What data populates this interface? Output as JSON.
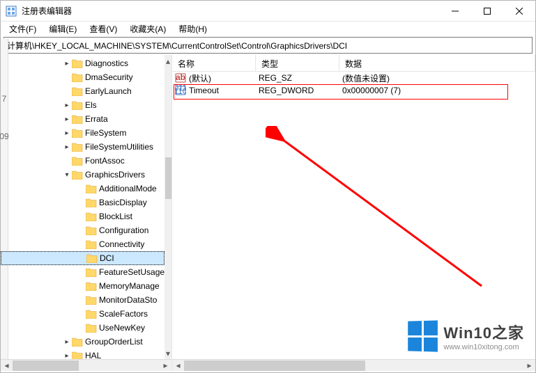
{
  "window": {
    "title": "注册表编辑器"
  },
  "menu": {
    "file": "文件(F)",
    "edit": "编辑(E)",
    "view": "查看(V)",
    "favorites": "收藏夹(A)",
    "help": "帮助(H)"
  },
  "path": "计算机\\HKEY_LOCAL_MACHINE\\SYSTEM\\CurrentControlSet\\Control\\GraphicsDrivers\\DCI",
  "tree": [
    {
      "indent": 88,
      "chev": ">",
      "label": "Diagnostics"
    },
    {
      "indent": 88,
      "chev": "",
      "label": "DmaSecurity"
    },
    {
      "indent": 88,
      "chev": "",
      "label": "EarlyLaunch"
    },
    {
      "indent": 88,
      "chev": ">",
      "label": "Els"
    },
    {
      "indent": 88,
      "chev": ">",
      "label": "Errata"
    },
    {
      "indent": 88,
      "chev": ">",
      "label": "FileSystem"
    },
    {
      "indent": 88,
      "chev": ">",
      "label": "FileSystemUtilities"
    },
    {
      "indent": 88,
      "chev": "",
      "label": "FontAssoc"
    },
    {
      "indent": 88,
      "chev": "v",
      "label": "GraphicsDrivers"
    },
    {
      "indent": 108,
      "chev": "",
      "label": "AdditionalMode"
    },
    {
      "indent": 108,
      "chev": "",
      "label": "BasicDisplay"
    },
    {
      "indent": 108,
      "chev": "",
      "label": "BlockList"
    },
    {
      "indent": 108,
      "chev": "",
      "label": "Configuration"
    },
    {
      "indent": 108,
      "chev": "",
      "label": "Connectivity"
    },
    {
      "indent": 108,
      "chev": "",
      "label": "DCI",
      "selected": true
    },
    {
      "indent": 108,
      "chev": "",
      "label": "FeatureSetUsage"
    },
    {
      "indent": 108,
      "chev": "",
      "label": "MemoryManage"
    },
    {
      "indent": 108,
      "chev": "",
      "label": "MonitorDataSto"
    },
    {
      "indent": 108,
      "chev": "",
      "label": "ScaleFactors"
    },
    {
      "indent": 108,
      "chev": "",
      "label": "UseNewKey"
    },
    {
      "indent": 88,
      "chev": ">",
      "label": "GroupOrderList"
    },
    {
      "indent": 88,
      "chev": ">",
      "label": "HAL"
    }
  ],
  "columns": {
    "name": "名称",
    "type": "类型",
    "data": "数据"
  },
  "values": [
    {
      "icon": "str",
      "name": "(默认)",
      "type": "REG_SZ",
      "data": "(数值未设置)"
    },
    {
      "icon": "bin",
      "name": "Timeout",
      "type": "REG_DWORD",
      "data": "0x00000007 (7)"
    }
  ],
  "left_strip": {
    "a": "7",
    "b": "09"
  },
  "watermark": {
    "title": "Win10之家",
    "url": "www.win10xitong.com"
  }
}
